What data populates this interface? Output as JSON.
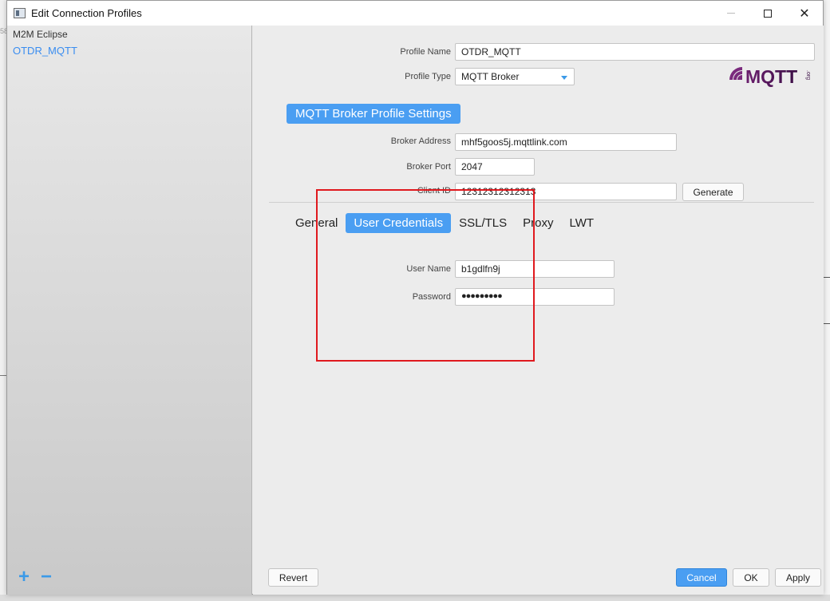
{
  "window": {
    "title": "Edit Connection Profiles",
    "controls": {
      "close": "✕"
    }
  },
  "background": {
    "left_fragment": "58"
  },
  "sidebar": {
    "items": [
      {
        "label": "M2M Eclipse",
        "selected": false
      },
      {
        "label": "OTDR_MQTT",
        "selected": true
      }
    ],
    "add_label": "+",
    "remove_label": "−"
  },
  "profile": {
    "name_label": "Profile Name",
    "name_value": "OTDR_MQTT",
    "type_label": "Profile Type",
    "type_value": "MQTT Broker"
  },
  "logo": {
    "text": "MQTT",
    "small": ".org"
  },
  "broker": {
    "section_title": "MQTT Broker Profile Settings",
    "address_label": "Broker Address",
    "address_value": "mhf5goos5j.mqttlink.com",
    "port_label": "Broker Port",
    "port_value": "2047",
    "client_label": "Client ID",
    "client_value": "12312312312313",
    "generate_label": "Generate"
  },
  "tabs": [
    {
      "label": "General",
      "active": false
    },
    {
      "label": "User Credentials",
      "active": true
    },
    {
      "label": "SSL/TLS",
      "active": false
    },
    {
      "label": "Proxy",
      "active": false
    },
    {
      "label": "LWT",
      "active": false
    }
  ],
  "credentials": {
    "username_label": "User Name",
    "username_value": "b1gdlfn9j",
    "password_label": "Password",
    "password_value": "●●●●●●●●●"
  },
  "footer": {
    "revert": "Revert",
    "cancel": "Cancel",
    "ok": "OK",
    "apply": "Apply"
  },
  "colors": {
    "accent": "#4a9ef2",
    "selected_text": "#3a8df0",
    "annotation": "#e0191e"
  }
}
